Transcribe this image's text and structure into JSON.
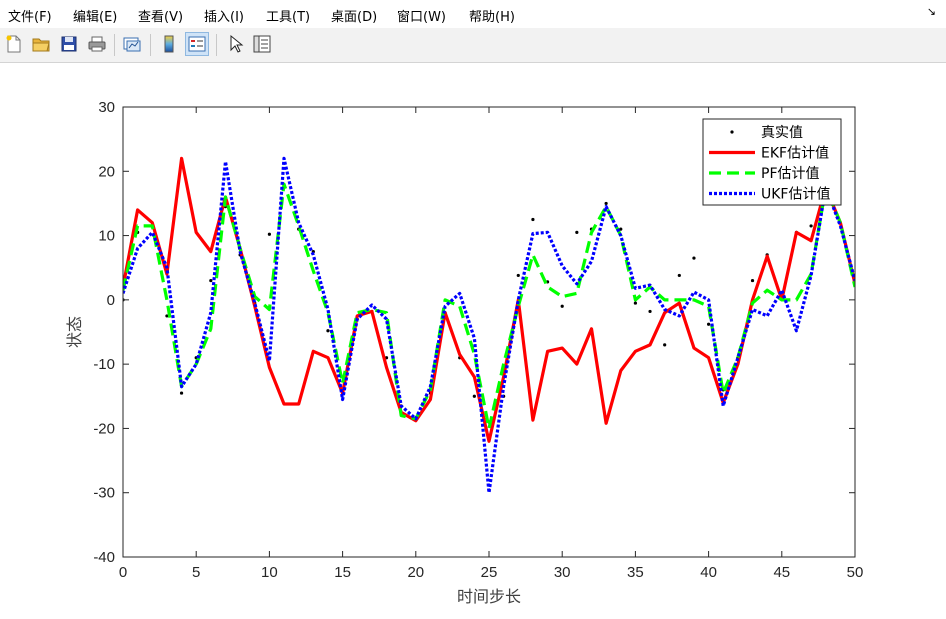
{
  "menu": [
    "文件(F)",
    "编辑(E)",
    "查看(V)",
    "插入(I)",
    "工具(T)",
    "桌面(D)",
    "窗口(W)",
    "帮助(H)"
  ],
  "window_arrow": "↘",
  "toolbar": [
    "new-file-icon",
    "open-folder-icon",
    "save-icon",
    "print-icon",
    "link-plot-icon",
    "insert-colorbar-icon",
    "insert-legend-icon",
    "pointer-icon",
    "property-inspector-icon"
  ],
  "chart_data": {
    "type": "line",
    "xlabel": "时间步长",
    "ylabel": "状态",
    "xlim": [
      0,
      50
    ],
    "ylim": [
      -40,
      30
    ],
    "xticks": [
      0,
      5,
      10,
      15,
      20,
      25,
      30,
      35,
      40,
      45,
      50
    ],
    "yticks": [
      -40,
      -30,
      -20,
      -10,
      0,
      10,
      20,
      30
    ],
    "legend_position": "top-right",
    "x": [
      0,
      1,
      2,
      3,
      4,
      5,
      6,
      7,
      8,
      9,
      10,
      11,
      12,
      13,
      14,
      15,
      16,
      17,
      18,
      19,
      20,
      21,
      22,
      23,
      24,
      25,
      26,
      27,
      28,
      29,
      30,
      31,
      32,
      33,
      34,
      35,
      36,
      37,
      38,
      39,
      40,
      41,
      42,
      43,
      44,
      45,
      46,
      47,
      48,
      49,
      50
    ],
    "series": [
      {
        "name": "真实值",
        "color": "#000000",
        "style": "points",
        "values": [
          0,
          10.5,
          11.5,
          -2.5,
          -14.5,
          -9,
          3,
          14.5,
          7,
          -0.5,
          10.2,
          17.5,
          11,
          7.5,
          -4.8,
          -14.5,
          -3,
          -1.8,
          -9,
          -16.5,
          -18.5,
          -14.5,
          -2,
          -9,
          -15,
          -19,
          -15,
          3.8,
          12.5,
          2.8,
          -1,
          10.5,
          11,
          15,
          11,
          -0.5,
          -1.8,
          -7,
          3.8,
          6.5,
          -3.8,
          -14,
          -9,
          3,
          7,
          1,
          10.5,
          11.5,
          17,
          12,
          3
        ]
      },
      {
        "name": "EKF估计值",
        "color": "#ff0000",
        "style": "solid",
        "values": [
          2,
          14,
          12,
          4,
          22,
          10.5,
          7.5,
          16,
          8,
          -1,
          -10.5,
          -16.2,
          -16.2,
          -8,
          -9,
          -14.5,
          -2.5,
          -1.8,
          -10.5,
          -17.5,
          -18.8,
          -15.5,
          -2,
          -8.5,
          -12,
          -22,
          -12,
          0,
          -18.7,
          -8,
          -7.5,
          -10,
          -4.5,
          -19.2,
          -11,
          -8,
          -7,
          -2,
          -0.5,
          -7.5,
          -9,
          -16,
          -10,
          0,
          6.8,
          0,
          10.5,
          9.2,
          17.5,
          12,
          2.5
        ]
      },
      {
        "name": "PF估计值",
        "color": "#00ff00",
        "style": "dashed",
        "values": [
          1.5,
          11.5,
          11.5,
          0,
          -13.5,
          -10,
          -4.5,
          16,
          8,
          0.5,
          -1.5,
          18,
          11.5,
          4.5,
          -2,
          -13,
          -2,
          -1.5,
          -2,
          -18,
          -18.5,
          -14,
          0,
          -1,
          -8.5,
          -20,
          -10,
          -1,
          7,
          2,
          0.5,
          1,
          10.5,
          14.5,
          10,
          0,
          2,
          0,
          0,
          0,
          -1,
          -14.5,
          -9,
          -0.5,
          1.5,
          0,
          0,
          4,
          17.5,
          12,
          2
        ]
      },
      {
        "name": "UKF估计值",
        "color": "#0000ff",
        "style": "dotted",
        "values": [
          1,
          8,
          10.5,
          5,
          -13.5,
          -10,
          -2,
          21.5,
          7.5,
          -0.5,
          -9.5,
          22,
          12,
          7,
          -1.5,
          -15.5,
          -3,
          -0.8,
          -3,
          -16.5,
          -18.5,
          -13.5,
          -1,
          1,
          -6,
          -30,
          -13.5,
          0,
          10.3,
          10.5,
          5.3,
          2.5,
          6,
          14.5,
          10,
          1.8,
          2.3,
          -1.5,
          -2.5,
          1.2,
          0,
          -16.5,
          -9,
          -1.5,
          -2.5,
          1.5,
          -4.8,
          3.8,
          17.5,
          11.5,
          3
        ]
      }
    ]
  }
}
